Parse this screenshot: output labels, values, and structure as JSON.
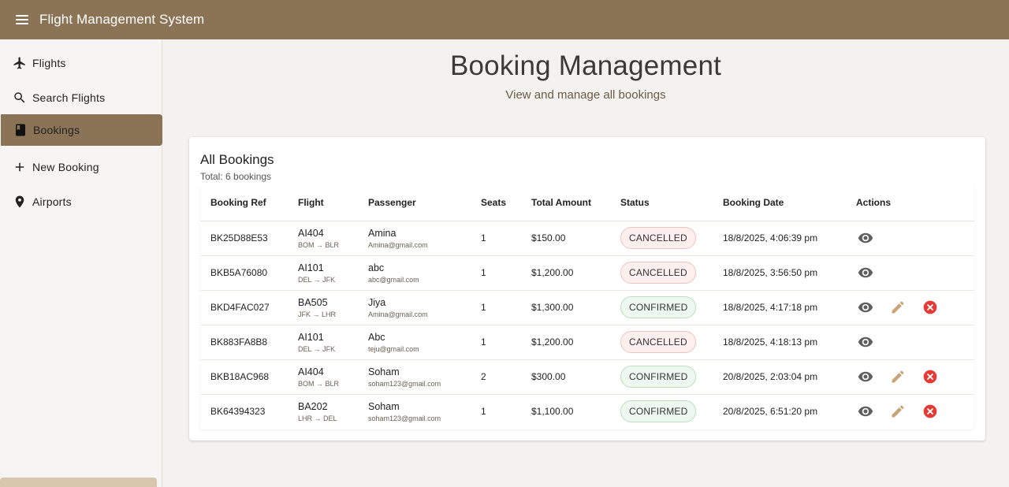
{
  "app": {
    "title": "Flight Management System"
  },
  "sidebar": {
    "items": [
      {
        "label": "Flights",
        "icon": "airplane-icon",
        "active": false
      },
      {
        "label": "Search Flights",
        "icon": "search-icon",
        "active": false
      },
      {
        "label": "Bookings",
        "icon": "book-icon",
        "active": true
      },
      {
        "label": "New Booking",
        "icon": "plus-icon",
        "active": false
      },
      {
        "label": "Airports",
        "icon": "location-pin-icon",
        "active": false
      }
    ]
  },
  "page": {
    "title": "Booking Management",
    "subtitle": "View and manage all bookings"
  },
  "card": {
    "title": "All Bookings",
    "subtitle": "Total: 6 bookings"
  },
  "table": {
    "headers": [
      "Booking Ref",
      "Flight",
      "Passenger",
      "Seats",
      "Total Amount",
      "Status",
      "Booking Date",
      "Actions"
    ],
    "rows": [
      {
        "ref": "BK25D88E53",
        "flight": "AI404",
        "route": "BOM → BLR",
        "name": "Amina",
        "email": "Amina@gmail.com",
        "seats": "1",
        "amount": "$150.00",
        "status": "CANCELLED",
        "date": "18/8/2025, 4:06:39 pm"
      },
      {
        "ref": "BKB5A76080",
        "flight": "AI101",
        "route": "DEL → JFK",
        "name": "abc",
        "email": "abc@gmail.com",
        "seats": "1",
        "amount": "$1,200.00",
        "status": "CANCELLED",
        "date": "18/8/2025, 3:56:50 pm"
      },
      {
        "ref": "BKD4FAC027",
        "flight": "BA505",
        "route": "JFK → LHR",
        "name": "Jiya",
        "email": "Amina@gmail.com",
        "seats": "1",
        "amount": "$1,300.00",
        "status": "CONFIRMED",
        "date": "18/8/2025, 4:17:18 pm"
      },
      {
        "ref": "BK883FA8B8",
        "flight": "AI101",
        "route": "DEL → JFK",
        "name": "Abc",
        "email": "teju@gmail.com",
        "seats": "1",
        "amount": "$1,200.00",
        "status": "CANCELLED",
        "date": "18/8/2025, 4:18:13 pm"
      },
      {
        "ref": "BKB18AC968",
        "flight": "AI404",
        "route": "BOM → BLR",
        "name": "Soham",
        "email": "soham123@gmail.com",
        "seats": "2",
        "amount": "$300.00",
        "status": "CONFIRMED",
        "date": "20/8/2025, 2:03:04 pm"
      },
      {
        "ref": "BK64394323",
        "flight": "BA202",
        "route": "LHR → DEL",
        "name": "Soham",
        "email": "soham123@gmail.com",
        "seats": "1",
        "amount": "$1,100.00",
        "status": "CONFIRMED",
        "date": "20/8/2025, 6:51:20 pm"
      }
    ]
  },
  "colors": {
    "primary": "#8b7355",
    "background": "#f4f2ef",
    "cancelled_bg": "#fcefee",
    "confirmed_bg": "#eef8f0",
    "edit_icon": "#c9a47a",
    "delete_icon": "#e53935",
    "view_icon": "#5f5f5f"
  }
}
